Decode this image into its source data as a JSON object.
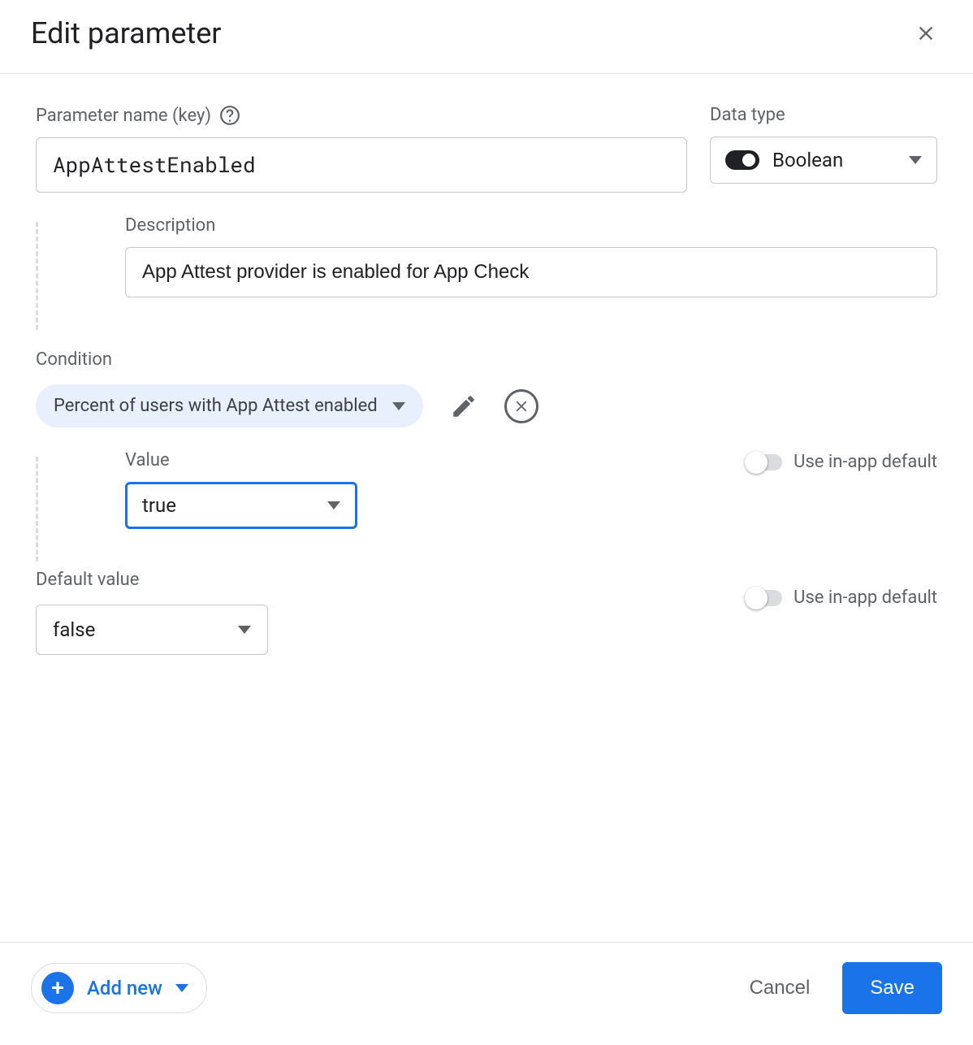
{
  "header": {
    "title": "Edit parameter"
  },
  "parameter": {
    "name_label": "Parameter name (key)",
    "name_value": "AppAttestEnabled",
    "type_label": "Data type",
    "type_value": "Boolean"
  },
  "description": {
    "label": "Description",
    "value": "App Attest provider is enabled for App Check"
  },
  "condition": {
    "section_label": "Condition",
    "chip_text": "Percent of users with App Attest enabled",
    "value_label": "Value",
    "value_selected": "true",
    "use_default_label": "Use in-app default"
  },
  "default_value": {
    "label": "Default value",
    "value": "false",
    "use_default_label": "Use in-app default"
  },
  "footer": {
    "add_new_label": "Add new",
    "cancel_label": "Cancel",
    "save_label": "Save"
  }
}
